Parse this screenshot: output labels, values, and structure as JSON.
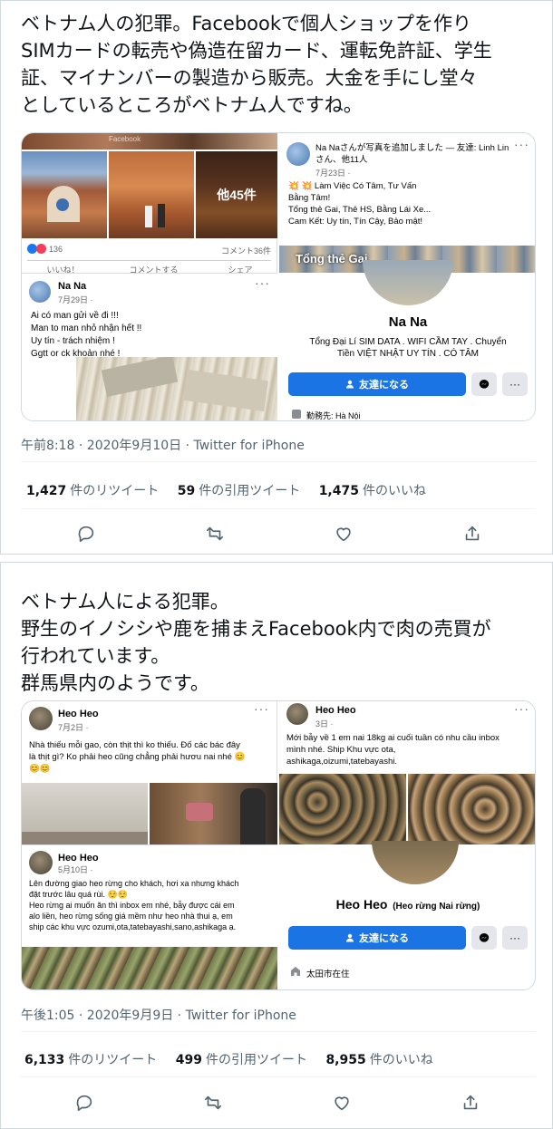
{
  "tweets": [
    {
      "text": "ベトナム人の犯罪。Facebookで個人ショップを作り\nSIMカードの転売や偽造在留カード、運転免許証、学生\n証、マイナンバーの製造から販売。大金を手にし堂々\nとしているところがベトナム人ですね。",
      "timestamp": "午前8:18 · 2020年9月10日 · Twitter for iPhone",
      "retweets_count": "1,427",
      "retweets_label": "件のリツイート",
      "quotes_count": "59",
      "quotes_label": "件の引用ツイート",
      "likes_count": "1,475",
      "likes_label": "件のいいね",
      "media": {
        "left_post": {
          "photo_caption": "Facebook",
          "more_photos": "他45件",
          "reaction_count": "136",
          "comment_count": "コメント36件",
          "action_like": "いいね！",
          "action_comment": "コメントする",
          "action_share": "シェア",
          "inner_name": "Na Na",
          "inner_date": "7月29日 · ",
          "inner_text": "Ai có man gửi về đi !!!\nMan to man nhỏ nhận hết !!\nUy tín - trách nhiệm !\nGgtt or ck khoản nhé !"
        },
        "right_post": {
          "header": "Na Naさんが写真を追加しました — 友達: Linh Linさん、他11人",
          "date": "7月23日 · ",
          "body": "💥 💥 Làm Việc Có Tâm, Tư Vấn\n    Bằng Tâm!\nTổng thẻ Gai, Thẻ HS, Bằng Lái Xe...\nCam Kết: Uy tín, Tín Cậy, Bảo mật!",
          "banner_text": "Tổng thẻ Gai",
          "profile_name": "Na Na",
          "profile_bio": "Tổng Đại Lí SIM DATA . WIFI CẦM TAY . Chuyển\nTiền VIỆT NHẬT UY TÍN . CÓ TÂM",
          "friend_button": "友達になる",
          "more_button": "···",
          "lives_in": "勤務先: Hà Nội"
        }
      }
    },
    {
      "text": "ベトナム人による犯罪。\n野生のイノシシや鹿を捕まえFacebook内で肉の売買が\n行われています。\n群馬県内のようです。",
      "timestamp": "午後1:05 · 2020年9月9日 · Twitter for iPhone",
      "retweets_count": "6,133",
      "retweets_label": "件のリツイート",
      "quotes_count": "499",
      "quotes_label": "件の引用ツイート",
      "likes_count": "8,955",
      "likes_label": "件のいいね",
      "media": {
        "post_a": {
          "name": "Heo Heo",
          "date": "7月2日 · ",
          "text": "Nhà thiếu mỗi gao, còn thịt thì ko thiếu. Đố các bác đây\nlà thịt gì? Ko phải heo cũng chẳng phải hươu nai nhé 😊\n😊😊"
        },
        "post_b": {
          "name": "Heo Heo",
          "date": "5月10日 · ",
          "text": "Lên đường giao heo rừng cho khách, hơi xa nhưng khách\nđặt trước lâu quá rùi. 😌😌\nHeo rừng ai muốn ăn thì inbox em nhé, bẫy được cái em\nalo liền, heo rừng sống giá mềm như heo nhà thui ạ, em\nship các khu vực ozumi,ota,tatebayashi,sano,ashikaga ạ."
        },
        "post_c": {
          "name": "Heo Heo",
          "date": "3日 · ",
          "text": "Mới bẫy về 1 em nai 18kg ai cuối tuần có nhu cầu inbox\nmình nhé. Ship Khu vực ota,\nashikaga,oizumi,tatebayashi."
        },
        "profile_name": "Heo Heo",
        "profile_sub": "(Heo rừng Nai rừng)",
        "friend_button": "友達になる",
        "more_button": "···",
        "lives_in": "太田市在住"
      }
    }
  ],
  "colors": {
    "fb_blue": "#1b74e4",
    "twitter_gray": "#536471",
    "border": "#cfd9de"
  },
  "icons": [
    "reply-icon",
    "retweet-icon",
    "like-icon",
    "share-icon",
    "messenger-icon",
    "add-friend-icon",
    "location-icon",
    "globe-icon"
  ]
}
